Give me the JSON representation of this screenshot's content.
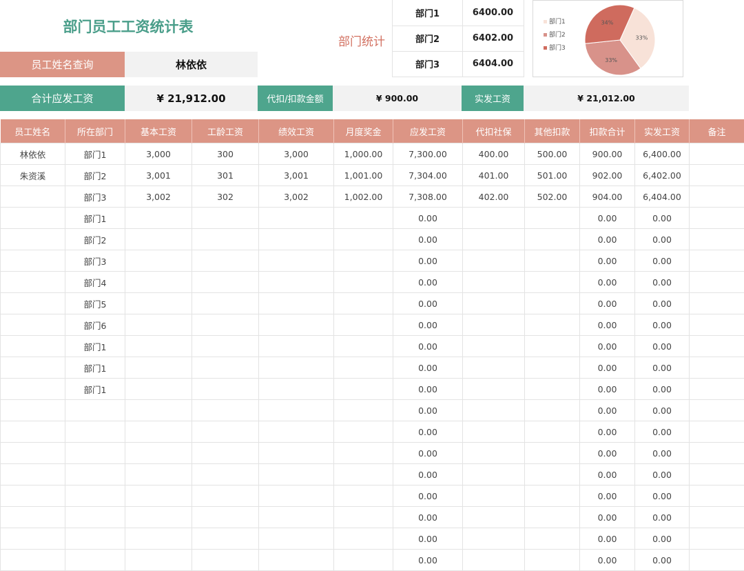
{
  "title": "部门员工工资统计表",
  "dept_stats": {
    "label": "部门统计",
    "rows": [
      {
        "name": "部门1",
        "value": "6400.00"
      },
      {
        "name": "部门2",
        "value": "6402.00"
      },
      {
        "name": "部门3",
        "value": "6404.00"
      }
    ]
  },
  "chart_data": {
    "type": "pie",
    "categories": [
      "部门1",
      "部门2",
      "部门3"
    ],
    "values": [
      6400,
      6402,
      6404
    ],
    "labels": [
      "33%",
      "33%",
      "34%"
    ],
    "colors": [
      "#f8e2d8",
      "#d8928a",
      "#cf6b5e"
    ],
    "legend": "left"
  },
  "lookup": {
    "label": "员工姓名查询",
    "value": "林依依"
  },
  "summary": {
    "total_label": "合计应发工资",
    "total_value": "¥ 21,912.00",
    "deduct_label": "代扣/扣款金额",
    "deduct_value": "¥ 900.00",
    "net_label": "实发工资",
    "net_value": "¥ 21,012.00"
  },
  "table": {
    "headers": [
      "员工姓名",
      "所在部门",
      "基本工资",
      "工龄工资",
      "绩效工资",
      "月度奖金",
      "应发工资",
      "代扣社保",
      "其他扣款",
      "扣款合计",
      "实发工资",
      "备注"
    ],
    "rows": [
      [
        "林依依",
        "部门1",
        "3,000",
        "300",
        "3,000",
        "1,000.00",
        "7,300.00",
        "400.00",
        "500.00",
        "900.00",
        "6,400.00",
        ""
      ],
      [
        "朱资溪",
        "部门2",
        "3,001",
        "301",
        "3,001",
        "1,001.00",
        "7,304.00",
        "401.00",
        "501.00",
        "902.00",
        "6,402.00",
        ""
      ],
      [
        "",
        "部门3",
        "3,002",
        "302",
        "3,002",
        "1,002.00",
        "7,308.00",
        "402.00",
        "502.00",
        "904.00",
        "6,404.00",
        ""
      ],
      [
        "",
        "部门1",
        "",
        "",
        "",
        "",
        "0.00",
        "",
        "",
        "0.00",
        "0.00",
        ""
      ],
      [
        "",
        "部门2",
        "",
        "",
        "",
        "",
        "0.00",
        "",
        "",
        "0.00",
        "0.00",
        ""
      ],
      [
        "",
        "部门3",
        "",
        "",
        "",
        "",
        "0.00",
        "",
        "",
        "0.00",
        "0.00",
        ""
      ],
      [
        "",
        "部门4",
        "",
        "",
        "",
        "",
        "0.00",
        "",
        "",
        "0.00",
        "0.00",
        ""
      ],
      [
        "",
        "部门5",
        "",
        "",
        "",
        "",
        "0.00",
        "",
        "",
        "0.00",
        "0.00",
        ""
      ],
      [
        "",
        "部门6",
        "",
        "",
        "",
        "",
        "0.00",
        "",
        "",
        "0.00",
        "0.00",
        ""
      ],
      [
        "",
        "部门1",
        "",
        "",
        "",
        "",
        "0.00",
        "",
        "",
        "0.00",
        "0.00",
        ""
      ],
      [
        "",
        "部门1",
        "",
        "",
        "",
        "",
        "0.00",
        "",
        "",
        "0.00",
        "0.00",
        ""
      ],
      [
        "",
        "部门1",
        "",
        "",
        "",
        "",
        "0.00",
        "",
        "",
        "0.00",
        "0.00",
        ""
      ],
      [
        "",
        "",
        "",
        "",
        "",
        "",
        "0.00",
        "",
        "",
        "0.00",
        "0.00",
        ""
      ],
      [
        "",
        "",
        "",
        "",
        "",
        "",
        "0.00",
        "",
        "",
        "0.00",
        "0.00",
        ""
      ],
      [
        "",
        "",
        "",
        "",
        "",
        "",
        "0.00",
        "",
        "",
        "0.00",
        "0.00",
        ""
      ],
      [
        "",
        "",
        "",
        "",
        "",
        "",
        "0.00",
        "",
        "",
        "0.00",
        "0.00",
        ""
      ],
      [
        "",
        "",
        "",
        "",
        "",
        "",
        "0.00",
        "",
        "",
        "0.00",
        "0.00",
        ""
      ],
      [
        "",
        "",
        "",
        "",
        "",
        "",
        "0.00",
        "",
        "",
        "0.00",
        "0.00",
        ""
      ],
      [
        "",
        "",
        "",
        "",
        "",
        "",
        "0.00",
        "",
        "",
        "0.00",
        "0.00",
        ""
      ],
      [
        "",
        "",
        "",
        "",
        "",
        "",
        "0.00",
        "",
        "",
        "0.00",
        "0.00",
        ""
      ]
    ]
  }
}
